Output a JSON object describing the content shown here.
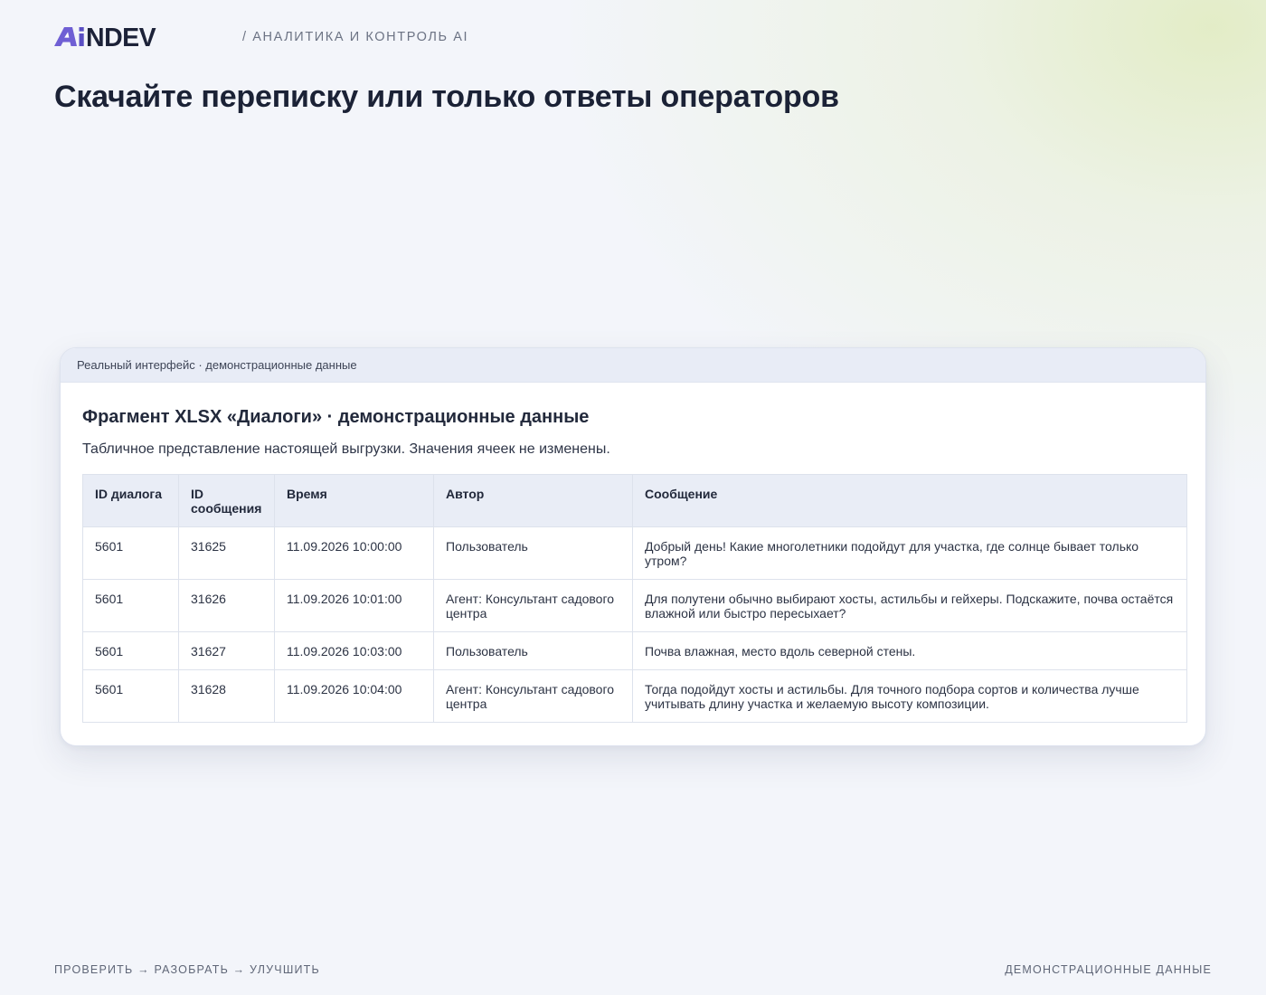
{
  "header": {
    "logo_text": "AiNDEV",
    "tagline": "/ АНАЛИТИКА И КОНТРОЛЬ AI",
    "title": "Скачайте переписку или только ответы операторов"
  },
  "card": {
    "bar_label": "Реальный интерфейс · демонстрационные данные",
    "title": "Фрагмент XLSX «Диалоги» · демонстрационные данные",
    "subtitle": "Табличное представление настоящей выгрузки. Значения ячеек не изменены.",
    "table": {
      "columns": [
        "ID диалога",
        "ID сообщения",
        "Время",
        "Автор",
        "Сообщение"
      ],
      "rows": [
        [
          "5601",
          "31625",
          "11.09.2026 10:00:00",
          "Пользователь",
          "Добрый день! Какие многолетники подойдут для участка, где солнце бывает только утром?"
        ],
        [
          "5601",
          "31626",
          "11.09.2026 10:01:00",
          "Агент: Консультант садового центра",
          "Для полутени обычно выбирают хосты, астильбы и гейхеры. Подскажите, почва остаётся влажной или быстро пересыхает?"
        ],
        [
          "5601",
          "31627",
          "11.09.2026 10:03:00",
          "Пользователь",
          "Почва влажная, место вдоль северной стены."
        ],
        [
          "5601",
          "31628",
          "11.09.2026 10:04:00",
          "Агент: Консультант садового центра",
          "Тогда подойдут хосты и астильбы. Для точного подбора сортов и количества лучше учитывать длину участка и желаемую высоту композиции."
        ]
      ]
    }
  },
  "footer": {
    "left": "ПРОВЕРИТЬ → РАЗОБРАТЬ → УЛУЧШИТЬ",
    "right": "ДЕМОНСТРАЦИОННЫЕ ДАННЫЕ"
  },
  "colors": {
    "logo_accent": "#6f5fd4",
    "logo_text": "#1c2238",
    "title": "#1b2236",
    "card_bar": "#e8ecf6",
    "table_header": "#e9edf6"
  }
}
